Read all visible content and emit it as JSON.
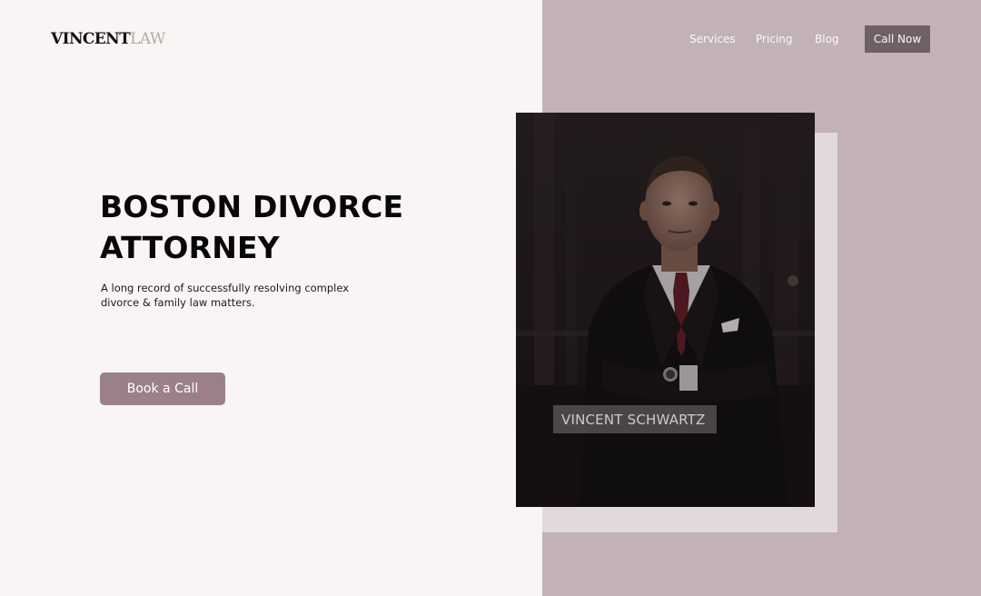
{
  "header": {
    "logo_primary": "VINCENT",
    "logo_secondary": "LAW",
    "nav": [
      "Services",
      "Pricing",
      "Blog"
    ],
    "cta_label": "Call Now"
  },
  "hero": {
    "title_line1": "BOSTON DIVORCE",
    "title_line2": "ATTORNEY",
    "subtitle_line1": "A long record of successfully resolving complex",
    "subtitle_line2": "divorce & family law matters.",
    "button_label": "Book a Call"
  },
  "profile": {
    "name": "VINCENT SCHWARTZ"
  },
  "colors": {
    "page_bg": "#f8f5f4",
    "panel_bg": "#c2b1b7",
    "accent_button": "#9c8088",
    "cta_bg": "#6f6067"
  }
}
